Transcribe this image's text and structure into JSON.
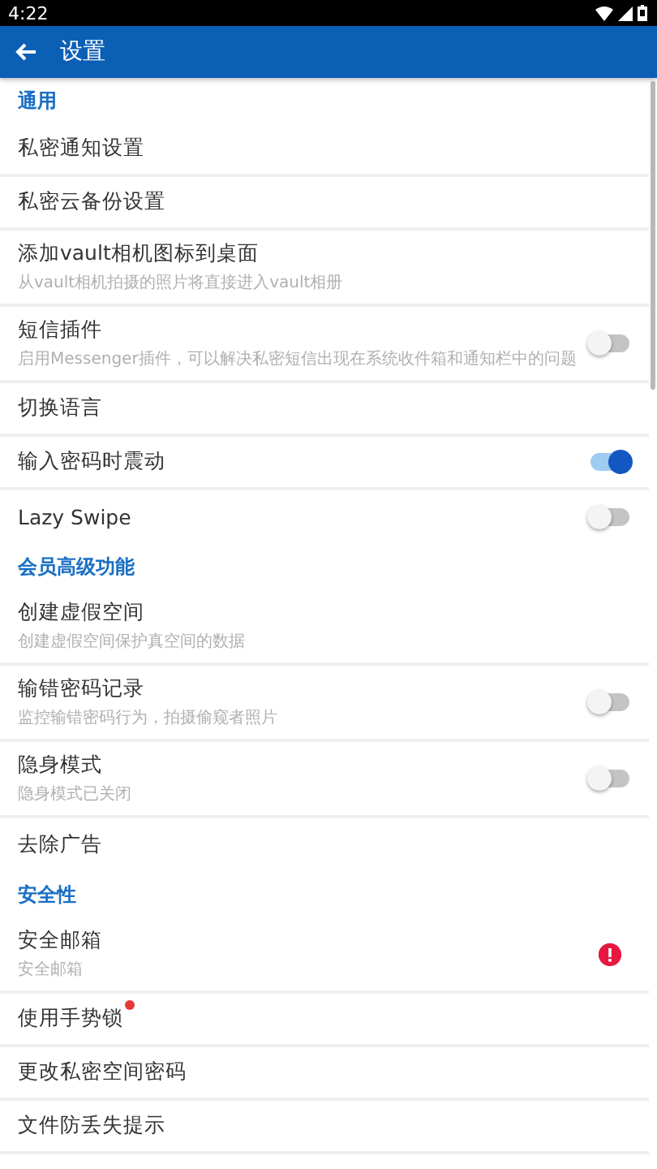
{
  "status_bar": {
    "time": "4:22"
  },
  "app_bar": {
    "title": "设置"
  },
  "items": [
    {
      "kind": "header",
      "title": "通用"
    },
    {
      "kind": "row",
      "title": "私密通知设置"
    },
    {
      "kind": "row",
      "title": "私密云备份设置"
    },
    {
      "kind": "row",
      "title": "添加vault相机图标到桌面",
      "subtitle": "从vault相机拍摄的照片将直接进入vault相册"
    },
    {
      "kind": "switch",
      "title": "短信插件",
      "subtitle": "启用Messenger插件，可以解决私密短信出现在系统收件箱和通知栏中的问题",
      "on": false
    },
    {
      "kind": "row",
      "title": "切换语言"
    },
    {
      "kind": "switch",
      "title": "输入密码时震动",
      "on": true
    },
    {
      "kind": "switch",
      "title": "Lazy Swipe",
      "on": false,
      "divider": false
    },
    {
      "kind": "header",
      "title": "会员高级功能"
    },
    {
      "kind": "row",
      "title": "创建虚假空间",
      "subtitle": "创建虚假空间保护真空间的数据"
    },
    {
      "kind": "switch",
      "title": "输错密码记录",
      "subtitle": "监控输错密码行为，拍摄偷窥者照片",
      "on": false
    },
    {
      "kind": "switch",
      "title": "隐身模式",
      "subtitle": "隐身模式已关闭",
      "on": false
    },
    {
      "kind": "row",
      "title": "去除广告",
      "divider": false
    },
    {
      "kind": "header",
      "title": "安全性"
    },
    {
      "kind": "alert",
      "title": "安全邮箱",
      "subtitle": "安全邮箱"
    },
    {
      "kind": "row",
      "title": "使用手势锁",
      "dot": true
    },
    {
      "kind": "row",
      "title": "更改私密空间密码"
    },
    {
      "kind": "row",
      "title": "文件防丢失提示"
    }
  ]
}
